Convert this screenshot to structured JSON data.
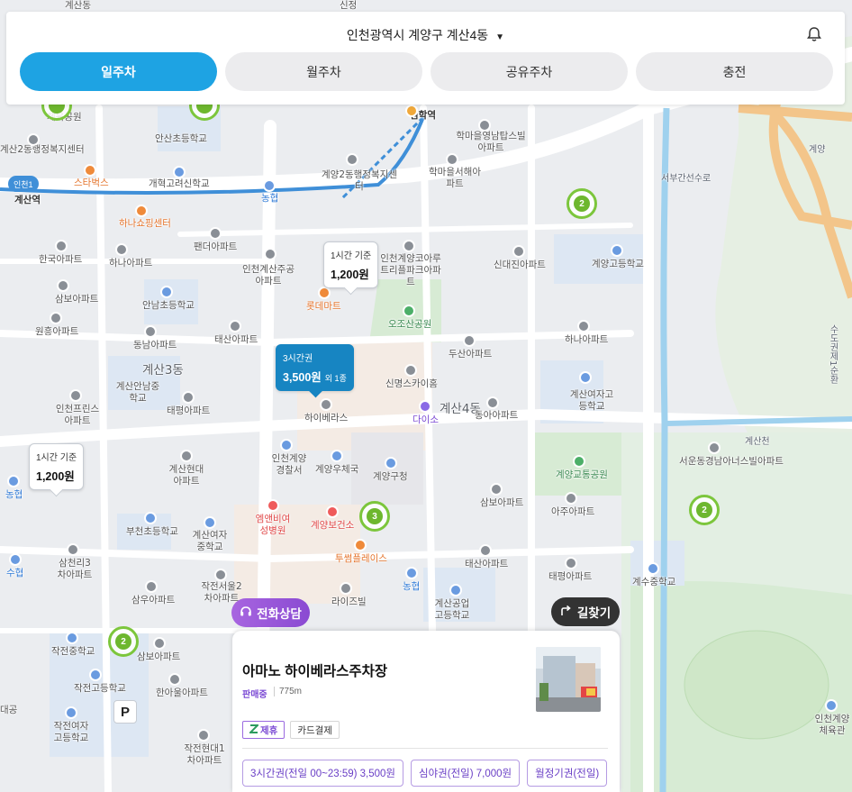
{
  "header": {
    "location": "인천광역시 계양구 계산4동",
    "caret": "▼",
    "bell_icon": "bell-icon"
  },
  "tabs": [
    {
      "label": "일주차",
      "active": true
    },
    {
      "label": "월주차",
      "active": false
    },
    {
      "label": "공유주차",
      "active": false
    },
    {
      "label": "충전",
      "active": false
    }
  ],
  "map": {
    "labels": {
      "gyesan_welfare_top": "계산2동행정복지센터",
      "jaeyuk_park": "체육공원",
      "ansan_elem": "안산초등학교",
      "gaehyeon": "개혁고려신학교",
      "gyeyang2_welfare": "계양2동행정복지센터",
      "imhak_station": "임학역",
      "imhak_apt": "학마을영남탑스빌아파트",
      "imhak_seohae": "학마을서해아파트",
      "gyesan2_welfare": "계산2동행정복지센터",
      "starbucks": "스타벅스",
      "gyesan_station": "계산역",
      "nonghyup1": "농협",
      "hana_shopping": "하나쇼핑센터",
      "hanguk_apt": "한국아파트",
      "hana_apt": "하나아파트",
      "pendeo_apt": "팬더아파트",
      "incheon_gyesanjugong": "인천계산주공아파트",
      "incheon_gyeyang_koaru": "인천계양코아루트리플파크아파트",
      "sindaejin_apt": "신대진아파트",
      "gyeyang_high": "계양고등학교",
      "seobu_road": "서부간선수로",
      "gyeyang_ic": "계양",
      "samho_apt": "삼보아파트",
      "anam_elem": "안남초등학교",
      "lotte_mart": "롯데마트",
      "ojosan_park": "오조산공원",
      "wonheung_apt": "원흥아파트",
      "dongnam_apt": "동남아파트",
      "taesan_apt": "태산아파트",
      "dusan_apt": "두산아파트",
      "hana_apt2": "하나아파트",
      "gyesan3_dong": "계산3동",
      "gyesananam_middle": "계산안남중학교",
      "sinmyeong": "신명스카이홈",
      "incheon_prince": "인천프린스아파트",
      "taepyeong_apt": "태평아파트",
      "hibellas": "하이베라스",
      "daiso": "다이소",
      "gyesan4_dong": "계산4동",
      "dongah_apt": "동아아파트",
      "gyesan_girls_high": "계산여자고등학교",
      "gyesancheon": "계산천",
      "seoun_apt": "서운동경남아너스빌아파트",
      "gyesan_hyundai": "계산현대아파트",
      "gyeyang_police": "인천계양경찰서",
      "gyeyang_post": "계양우체국",
      "gyeyang_office": "계양구청",
      "gyeyang_park": "계양교통공원",
      "nonghyup2": "농협",
      "mnb_hospital": "엠앤비여성병원",
      "gyeyang_health": "계양보건소",
      "samho_apt2": "삼보아파트",
      "aju_apt": "아주아파트",
      "bucheon_elem": "부천초등학교",
      "gyesan_girls_middle": "계산여자중학교",
      "suhyeon": "수협",
      "samcheonli": "삼천리3차아파트",
      "tusum_place": "투썸플레이스",
      "taesan_apt2": "태산아파트",
      "taepyeong_apt2": "태평아파트",
      "gyesu_middle": "계수중학교",
      "samu_apt": "삼우아파트",
      "jaksan_seoul": "작전서울2차아파트",
      "nonghyup3": "농협",
      "lavil": "라이즈빌",
      "gyesan_tech_high": "계산공업고등학교",
      "jakjeon_middle": "작전중학교",
      "samho_apt3": "삼보아파트",
      "jakjeon_high": "작전고등학교",
      "hanaul_apt": "한아울아파트",
      "jakjeon_girls_high": "작전여자고등학교",
      "jakjeon_hyundai": "작전현대1차아파트",
      "incheon_gyeyang_gym": "인천계양체육관",
      "sudogwon": "수도권제1순환",
      "daegeon": "대공",
      "gyesan_top": "계산동",
      "sinjeong": "신정"
    },
    "markers": {
      "tag_a": {
        "title": "1시간 기준",
        "price": "1,200원"
      },
      "tag_b": {
        "title": "1시간 기준",
        "price": "1,200원"
      },
      "tag_active": {
        "title": "3시간권",
        "price": "3,500원",
        "sub": "외 1종"
      }
    },
    "clusters": [
      "2",
      "3",
      "2",
      "2"
    ],
    "parking_badge": "P",
    "line_badge": "인천1"
  },
  "actions": {
    "consult_label": "전화상담",
    "route_label": "길찾기"
  },
  "card": {
    "title": "아마노 하이베라스주차장",
    "status": "판매중",
    "distance": "775m",
    "badges": {
      "partner": "제휴",
      "card": "카드결제"
    },
    "tickets": [
      "3시간권(전일 00~23:59) 3,500원",
      "심야권(전일) 7,000원",
      "월정기권(전일)"
    ]
  },
  "colors": {
    "accent": "#1ea3e3",
    "active_marker": "#1785c2",
    "purple": "#7b4ad4",
    "cluster_green": "#6db72e"
  }
}
